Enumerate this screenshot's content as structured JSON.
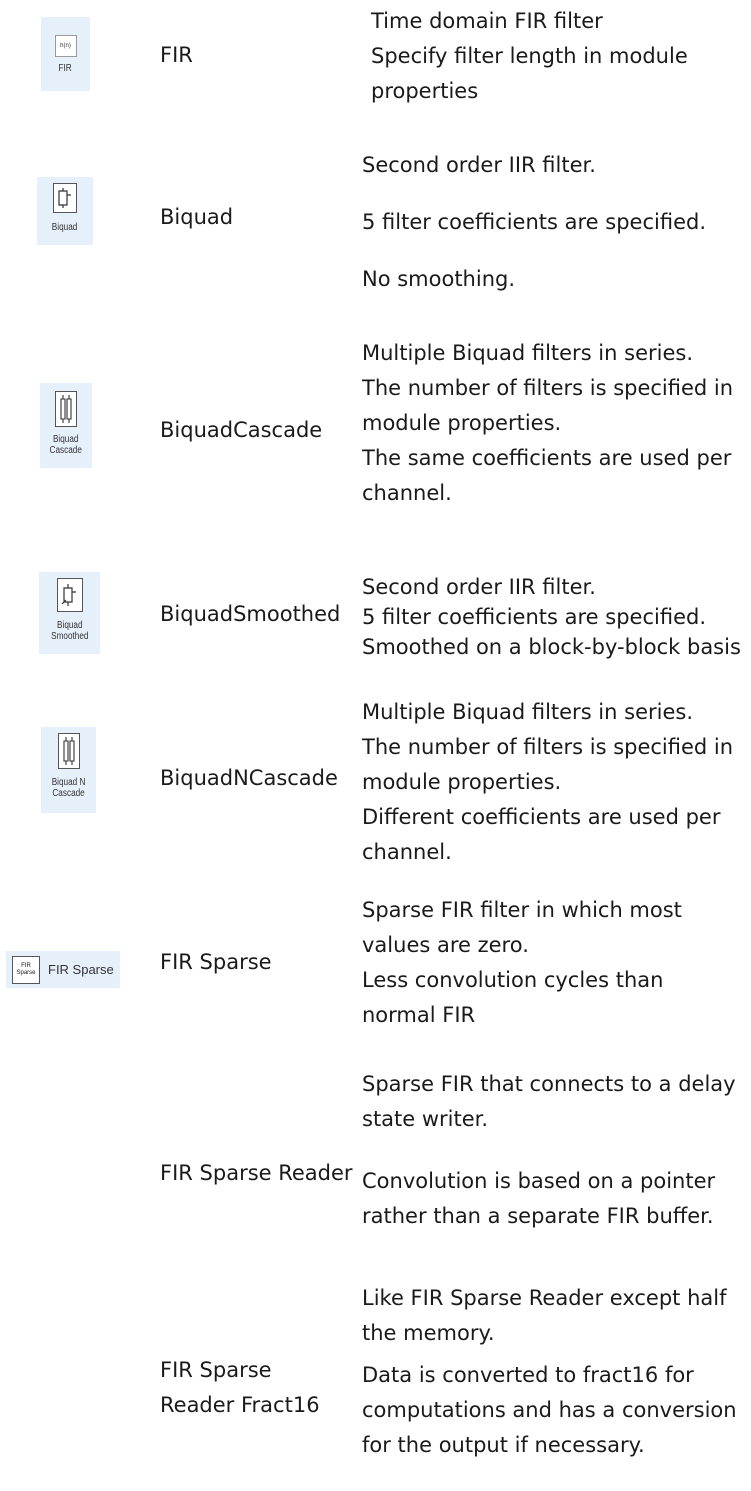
{
  "rows": [
    {
      "icon": {
        "name": "fir-icon",
        "glyph": "h(n)",
        "caption": "FIR"
      },
      "name": "FIR",
      "desc": [
        "Time domain FIR filter",
        "Specify filter length in module",
        "properties"
      ]
    },
    {
      "icon": {
        "name": "biquad-icon",
        "caption": "Biquad"
      },
      "name": "Biquad",
      "desc": [
        "Second order IIR filter.",
        "5 filter coefficients are specified.",
        "No smoothing."
      ]
    },
    {
      "icon": {
        "name": "biquad-cascade-icon",
        "caption": "Biquad\nCascade"
      },
      "name": "BiquadCascade",
      "desc": [
        "Multiple Biquad filters in series.",
        "The number of filters is specified in",
        "module properties.",
        "The same coefficients are used per",
        "channel."
      ]
    },
    {
      "icon": {
        "name": "biquad-smoothed-icon",
        "caption": "Biquad\nSmoothed"
      },
      "name": "BiquadSmoothed",
      "desc": [
        "Second order IIR filter.",
        "5 filter coefficients are specified.",
        "Smoothed on a block-by-block basis"
      ]
    },
    {
      "icon": {
        "name": "biquad-n-cascade-icon",
        "caption": "Biquad N\nCascade"
      },
      "name": "BiquadNCascade",
      "desc": [
        "Multiple Biquad filters in series.",
        "The number of filters is specified in",
        "module properties.",
        "Different coefficients are used per",
        "channel."
      ]
    },
    {
      "icon": {
        "name": "fir-sparse-icon",
        "glyph_top": "FIR",
        "glyph_bottom": "Sparse",
        "label": "FIR Sparse"
      },
      "name": "FIR Sparse",
      "desc": [
        "Sparse FIR filter in which most",
        "values are zero.",
        "Less convolution cycles than",
        "normal FIR"
      ]
    },
    {
      "name": "FIR Sparse Reader",
      "desc": [
        "Sparse FIR that connects to a delay",
        "state writer.",
        "Convolution is based on a pointer",
        "rather than a separate FIR buffer."
      ]
    },
    {
      "name_lines": [
        "FIR Sparse",
        "Reader Fract16"
      ],
      "desc": [
        "Like FIR Sparse Reader except half",
        "the memory.",
        "Data is converted to fract16 for",
        "computations and has a conversion",
        "for the output if necessary."
      ]
    }
  ]
}
